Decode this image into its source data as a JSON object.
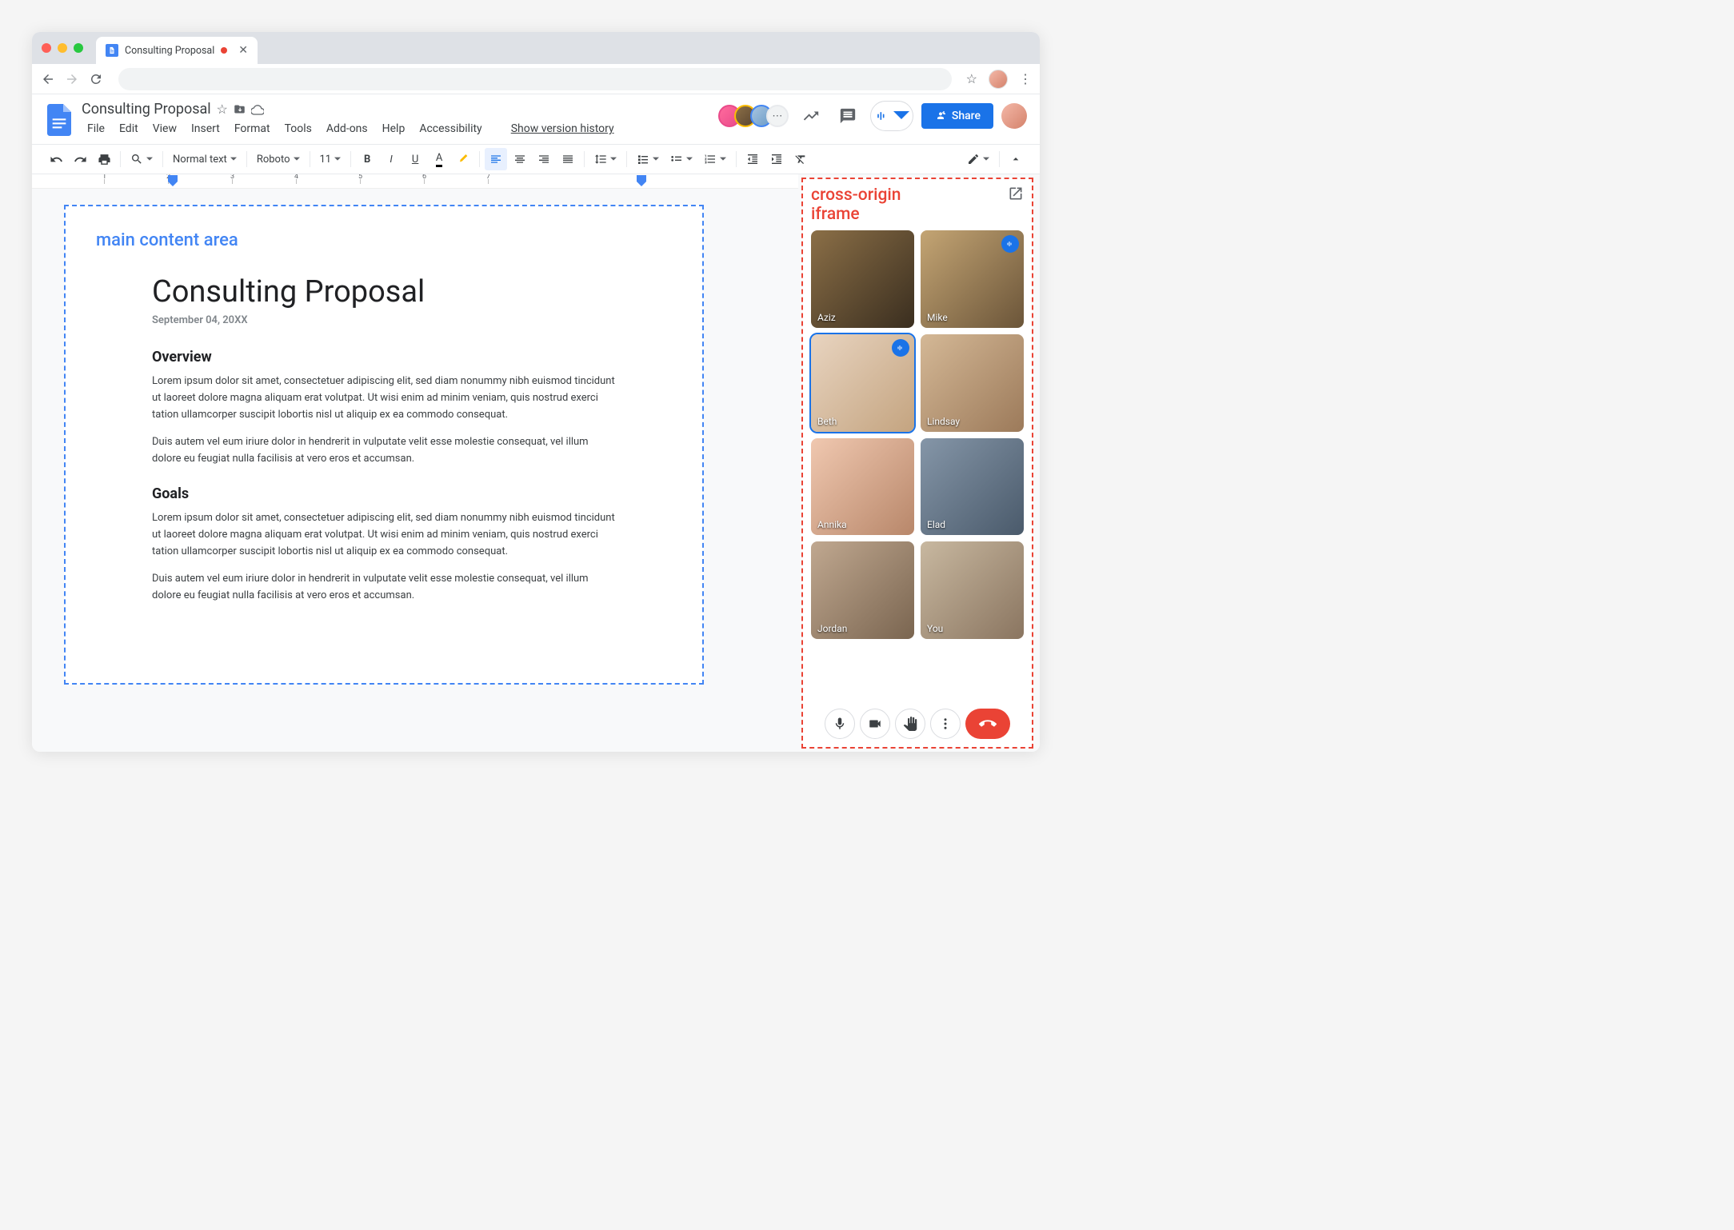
{
  "browser": {
    "tab_title": "Consulting Proposal",
    "tab_modified": true
  },
  "docs_header": {
    "title": "Consulting Proposal",
    "menus": [
      "File",
      "Edit",
      "View",
      "Insert",
      "Format",
      "Tools",
      "Add-ons",
      "Help",
      "Accessibility"
    ],
    "version_link": "Show version history",
    "share_label": "Share",
    "overflow_collaborators": "⋯"
  },
  "toolbar": {
    "style_dd": "Normal text",
    "font_dd": "Roboto",
    "size_dd": "11",
    "zoom": "",
    "bold": "B",
    "italic": "I",
    "underline": "U",
    "textcolor": "A"
  },
  "ruler": {
    "ticks": [
      "1",
      "2",
      "3",
      "4",
      "5",
      "6",
      "7"
    ]
  },
  "annotations": {
    "main": "main content area",
    "iframe_l1": "cross-origin",
    "iframe_l2": "iframe"
  },
  "document": {
    "h1": "Consulting Proposal",
    "date": "September 04, 20XX",
    "sections": [
      {
        "heading": "Overview",
        "paragraphs": [
          "Lorem ipsum dolor sit amet, consectetuer adipiscing elit, sed diam nonummy nibh euismod tincidunt ut laoreet dolore magna aliquam erat volutpat. Ut wisi enim ad minim veniam, quis nostrud exerci tation ullamcorper suscipit lobortis nisl ut aliquip ex ea commodo consequat.",
          "Duis autem vel eum iriure dolor in hendrerit in vulputate velit esse molestie consequat, vel illum dolore eu feugiat nulla facilisis at vero eros et accumsan."
        ]
      },
      {
        "heading": "Goals",
        "paragraphs": [
          "Lorem ipsum dolor sit amet, consectetuer adipiscing elit, sed diam nonummy nibh euismod tincidunt ut laoreet dolore magna aliquam erat volutpat. Ut wisi enim ad minim veniam, quis nostrud exerci tation ullamcorper suscipit lobortis nisl ut aliquip ex ea commodo consequat.",
          "Duis autem vel eum iriure dolor in hendrerit in vulputate velit esse molestie consequat, vel illum dolore eu feugiat nulla facilisis at vero eros et accumsan."
        ]
      }
    ]
  },
  "meet": {
    "participants": [
      {
        "name": "Aziz",
        "speaking": false,
        "highlighted": false,
        "palette": "p1"
      },
      {
        "name": "Mike",
        "speaking": true,
        "highlighted": false,
        "palette": "p2"
      },
      {
        "name": "Beth",
        "speaking": true,
        "highlighted": true,
        "palette": "p3"
      },
      {
        "name": "Lindsay",
        "speaking": false,
        "highlighted": false,
        "palette": "p4"
      },
      {
        "name": "Annika",
        "speaking": false,
        "highlighted": false,
        "palette": "p5"
      },
      {
        "name": "Elad",
        "speaking": false,
        "highlighted": false,
        "palette": "p6"
      },
      {
        "name": "Jordan",
        "speaking": false,
        "highlighted": false,
        "palette": "p7"
      },
      {
        "name": "You",
        "speaking": false,
        "highlighted": false,
        "palette": "p8"
      }
    ]
  }
}
